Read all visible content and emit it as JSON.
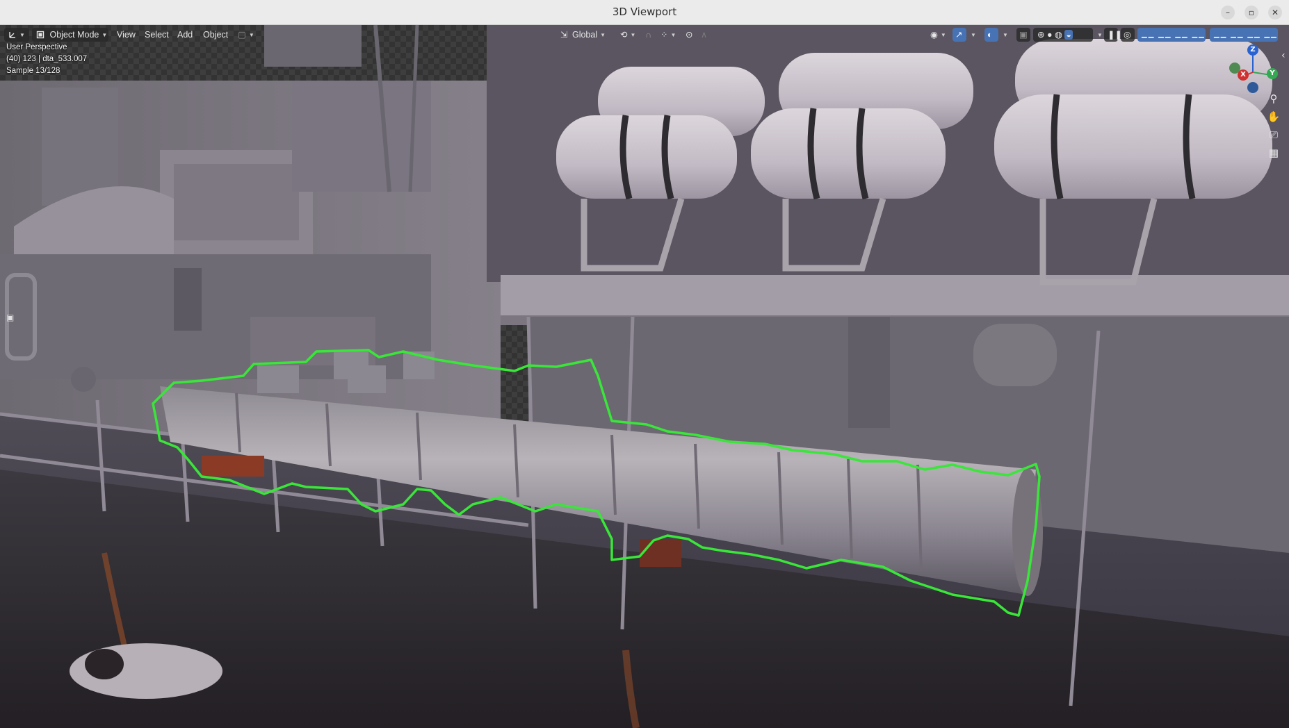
{
  "window": {
    "title": "3D Viewport",
    "controls": {
      "minimize": "–",
      "maximize": "▫",
      "close": "✕"
    }
  },
  "header": {
    "editor_type_icon": "editor-type-icon",
    "mode": "Object Mode",
    "menus": {
      "view": "View",
      "select": "Select",
      "add": "Add",
      "object": "Object"
    },
    "transform_orientation": "Global",
    "accent_color": "#4772b3"
  },
  "overlay": {
    "perspective": "User Perspective",
    "object_info": "(40) 123 | dta_533.007",
    "samples": "Sample 13/128"
  },
  "gizmo": {
    "x": "X",
    "y": "Y",
    "z": "Z"
  },
  "outline_color": "#39e639"
}
